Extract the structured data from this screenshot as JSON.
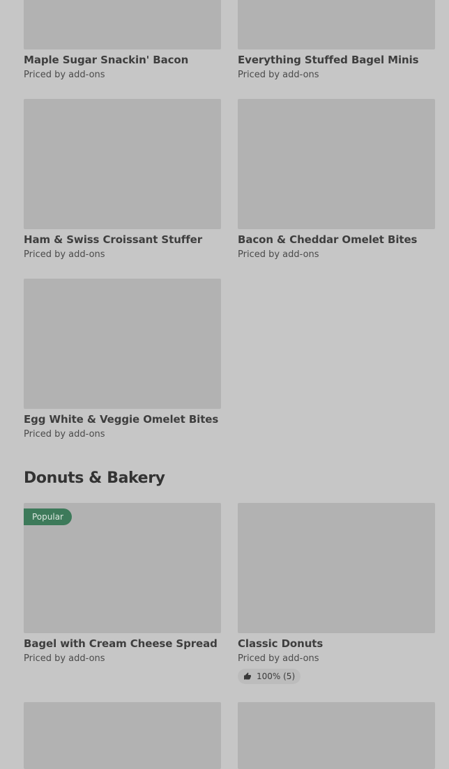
{
  "items_top": [
    {
      "title": "Maple Sugar Snackin' Bacon",
      "price": "Priced by add-ons"
    },
    {
      "title": "Everything Stuffed Bagel Minis",
      "price": "Priced by add-ons"
    },
    {
      "title": "Ham & Swiss Croissant Stuffer",
      "price": "Priced by add-ons"
    },
    {
      "title": "Bacon & Cheddar Omelet Bites",
      "price": "Priced by add-ons"
    },
    {
      "title": "Egg White & Veggie Omelet Bites",
      "price": "Priced by add-ons"
    }
  ],
  "section": {
    "title": "Donuts & Bakery",
    "items": [
      {
        "title": "Bagel with Cream Cheese Spread",
        "price": "Priced by add-ons",
        "badge": "Popular"
      },
      {
        "title": "Classic Donuts",
        "price": "Priced by add-ons",
        "rating": "100% (5)"
      }
    ]
  },
  "colors": {
    "badge": "#3d7a5a",
    "thumb": "#b2b2b2",
    "background": "#c6c6c6"
  },
  "icons": {
    "rating": "thumbs-up-icon"
  }
}
